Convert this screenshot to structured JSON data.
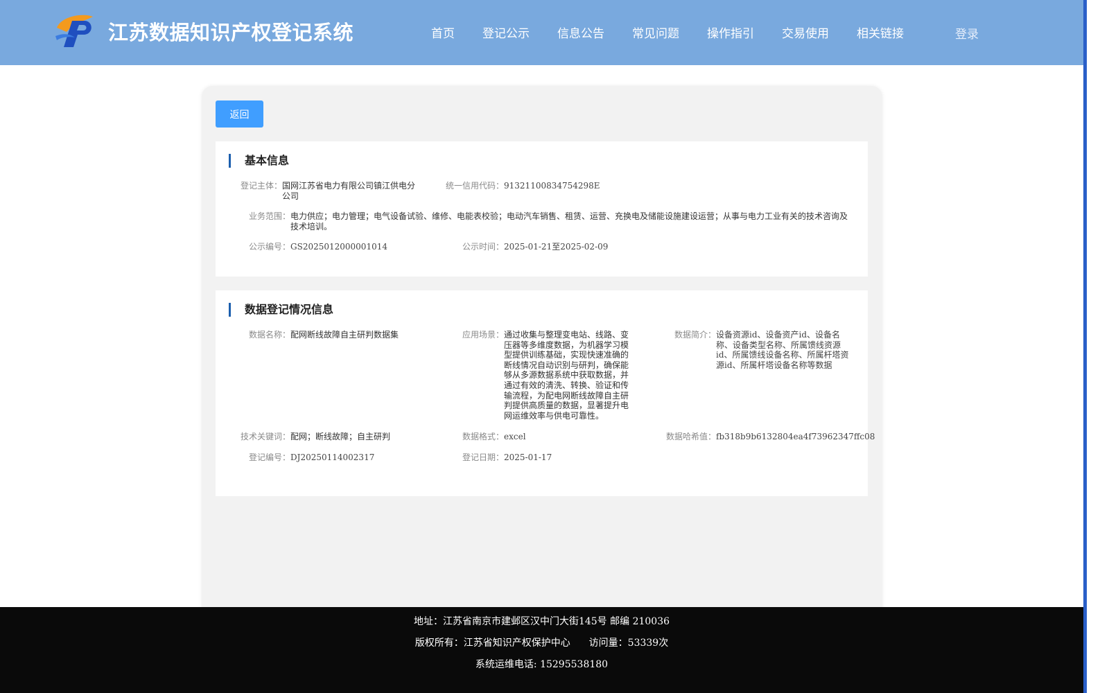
{
  "header": {
    "site_title": "江苏数据知识产权登记系统",
    "nav": [
      "首页",
      "登记公示",
      "信息公告",
      "常见问题",
      "操作指引",
      "交易使用",
      "相关链接"
    ],
    "login": "登录"
  },
  "toolbar": {
    "back_label": "返回"
  },
  "basic_info": {
    "title": "基本信息",
    "subject_label": "登记主体：",
    "subject": "国网江苏省电力有限公司镇江供电分公司",
    "credit_code_label": "统一信用代码：",
    "credit_code": "91321100834754298E",
    "scope_label": "业务范围：",
    "scope": "电力供应；电力管理；电气设备试验、维修、电能表校验；电动汽车销售、租赁、运营、充换电及储能设施建设运营；从事与电力工业有关的技术咨询及技术培训。",
    "notice_no_label": "公示编号：",
    "notice_no": "GS2025012000001014",
    "notice_time_label": "公示时间：",
    "notice_time": "2025-01-21至2025-02-09"
  },
  "registration_info": {
    "title": "数据登记情况信息",
    "data_name_label": "数据名称：",
    "data_name": "配网断线故障自主研判数据集",
    "scenario_label": "应用场景：",
    "scenario": "通过收集与整理变电站、线路、变压器等多维度数据，为机器学习模型提供训练基础，实现快速准确的断线情况自动识别与研判，确保能够从多源数据系统中获取数据，并通过有效的清洗、转换、验证和传输流程，为配电网断线故障自主研判提供高质量的数据，显著提升电网运维效率与供电可靠性。",
    "intro_label": "数据简介：",
    "intro": "设备资源id、设备资产id、设备名称、设备类型名称、所属馈线资源id、所属馈线设备名称、所属杆塔资源id、所属杆塔设备名称等数据",
    "keywords_label": "技术关键词：",
    "keywords": "配网；断线故障；自主研判",
    "format_label": "数据格式：",
    "format": "excel",
    "hash_label": "数据哈希值：",
    "hash": "fb318b9b6132804ea4f73962347ffc08",
    "reg_no_label": "登记编号：",
    "reg_no": "DJ20250114002317",
    "reg_date_label": "登记日期：",
    "reg_date": "2025-01-17"
  },
  "footer": {
    "address": "地址：江苏省南京市建邺区汉中门大街145号 邮编 210036",
    "copyright": "版权所有：江苏省知识产权保护中心",
    "visits": "访问量：53339次",
    "phone": "系统运维电话: 15295538180"
  },
  "colors": {
    "header_bg": "#79a9de",
    "primary_button": "#409eff",
    "section_accent": "#1d5fae",
    "footer_bg": "#0a0a0a"
  }
}
